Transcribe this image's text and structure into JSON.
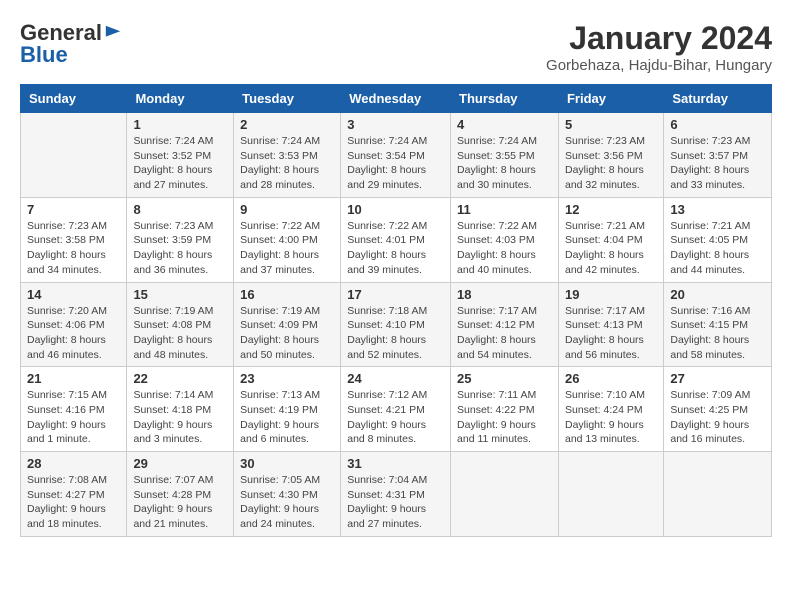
{
  "header": {
    "logo_line1": "General",
    "logo_line2": "Blue",
    "month_year": "January 2024",
    "location": "Gorbehaza, Hajdu-Bihar, Hungary"
  },
  "days_of_week": [
    "Sunday",
    "Monday",
    "Tuesday",
    "Wednesday",
    "Thursday",
    "Friday",
    "Saturday"
  ],
  "weeks": [
    [
      {
        "day": "",
        "sunrise": "",
        "sunset": "",
        "daylight": ""
      },
      {
        "day": "1",
        "sunrise": "Sunrise: 7:24 AM",
        "sunset": "Sunset: 3:52 PM",
        "daylight": "Daylight: 8 hours and 27 minutes."
      },
      {
        "day": "2",
        "sunrise": "Sunrise: 7:24 AM",
        "sunset": "Sunset: 3:53 PM",
        "daylight": "Daylight: 8 hours and 28 minutes."
      },
      {
        "day": "3",
        "sunrise": "Sunrise: 7:24 AM",
        "sunset": "Sunset: 3:54 PM",
        "daylight": "Daylight: 8 hours and 29 minutes."
      },
      {
        "day": "4",
        "sunrise": "Sunrise: 7:24 AM",
        "sunset": "Sunset: 3:55 PM",
        "daylight": "Daylight: 8 hours and 30 minutes."
      },
      {
        "day": "5",
        "sunrise": "Sunrise: 7:23 AM",
        "sunset": "Sunset: 3:56 PM",
        "daylight": "Daylight: 8 hours and 32 minutes."
      },
      {
        "day": "6",
        "sunrise": "Sunrise: 7:23 AM",
        "sunset": "Sunset: 3:57 PM",
        "daylight": "Daylight: 8 hours and 33 minutes."
      }
    ],
    [
      {
        "day": "7",
        "sunrise": "Sunrise: 7:23 AM",
        "sunset": "Sunset: 3:58 PM",
        "daylight": "Daylight: 8 hours and 34 minutes."
      },
      {
        "day": "8",
        "sunrise": "Sunrise: 7:23 AM",
        "sunset": "Sunset: 3:59 PM",
        "daylight": "Daylight: 8 hours and 36 minutes."
      },
      {
        "day": "9",
        "sunrise": "Sunrise: 7:22 AM",
        "sunset": "Sunset: 4:00 PM",
        "daylight": "Daylight: 8 hours and 37 minutes."
      },
      {
        "day": "10",
        "sunrise": "Sunrise: 7:22 AM",
        "sunset": "Sunset: 4:01 PM",
        "daylight": "Daylight: 8 hours and 39 minutes."
      },
      {
        "day": "11",
        "sunrise": "Sunrise: 7:22 AM",
        "sunset": "Sunset: 4:03 PM",
        "daylight": "Daylight: 8 hours and 40 minutes."
      },
      {
        "day": "12",
        "sunrise": "Sunrise: 7:21 AM",
        "sunset": "Sunset: 4:04 PM",
        "daylight": "Daylight: 8 hours and 42 minutes."
      },
      {
        "day": "13",
        "sunrise": "Sunrise: 7:21 AM",
        "sunset": "Sunset: 4:05 PM",
        "daylight": "Daylight: 8 hours and 44 minutes."
      }
    ],
    [
      {
        "day": "14",
        "sunrise": "Sunrise: 7:20 AM",
        "sunset": "Sunset: 4:06 PM",
        "daylight": "Daylight: 8 hours and 46 minutes."
      },
      {
        "day": "15",
        "sunrise": "Sunrise: 7:19 AM",
        "sunset": "Sunset: 4:08 PM",
        "daylight": "Daylight: 8 hours and 48 minutes."
      },
      {
        "day": "16",
        "sunrise": "Sunrise: 7:19 AM",
        "sunset": "Sunset: 4:09 PM",
        "daylight": "Daylight: 8 hours and 50 minutes."
      },
      {
        "day": "17",
        "sunrise": "Sunrise: 7:18 AM",
        "sunset": "Sunset: 4:10 PM",
        "daylight": "Daylight: 8 hours and 52 minutes."
      },
      {
        "day": "18",
        "sunrise": "Sunrise: 7:17 AM",
        "sunset": "Sunset: 4:12 PM",
        "daylight": "Daylight: 8 hours and 54 minutes."
      },
      {
        "day": "19",
        "sunrise": "Sunrise: 7:17 AM",
        "sunset": "Sunset: 4:13 PM",
        "daylight": "Daylight: 8 hours and 56 minutes."
      },
      {
        "day": "20",
        "sunrise": "Sunrise: 7:16 AM",
        "sunset": "Sunset: 4:15 PM",
        "daylight": "Daylight: 8 hours and 58 minutes."
      }
    ],
    [
      {
        "day": "21",
        "sunrise": "Sunrise: 7:15 AM",
        "sunset": "Sunset: 4:16 PM",
        "daylight": "Daylight: 9 hours and 1 minute."
      },
      {
        "day": "22",
        "sunrise": "Sunrise: 7:14 AM",
        "sunset": "Sunset: 4:18 PM",
        "daylight": "Daylight: 9 hours and 3 minutes."
      },
      {
        "day": "23",
        "sunrise": "Sunrise: 7:13 AM",
        "sunset": "Sunset: 4:19 PM",
        "daylight": "Daylight: 9 hours and 6 minutes."
      },
      {
        "day": "24",
        "sunrise": "Sunrise: 7:12 AM",
        "sunset": "Sunset: 4:21 PM",
        "daylight": "Daylight: 9 hours and 8 minutes."
      },
      {
        "day": "25",
        "sunrise": "Sunrise: 7:11 AM",
        "sunset": "Sunset: 4:22 PM",
        "daylight": "Daylight: 9 hours and 11 minutes."
      },
      {
        "day": "26",
        "sunrise": "Sunrise: 7:10 AM",
        "sunset": "Sunset: 4:24 PM",
        "daylight": "Daylight: 9 hours and 13 minutes."
      },
      {
        "day": "27",
        "sunrise": "Sunrise: 7:09 AM",
        "sunset": "Sunset: 4:25 PM",
        "daylight": "Daylight: 9 hours and 16 minutes."
      }
    ],
    [
      {
        "day": "28",
        "sunrise": "Sunrise: 7:08 AM",
        "sunset": "Sunset: 4:27 PM",
        "daylight": "Daylight: 9 hours and 18 minutes."
      },
      {
        "day": "29",
        "sunrise": "Sunrise: 7:07 AM",
        "sunset": "Sunset: 4:28 PM",
        "daylight": "Daylight: 9 hours and 21 minutes."
      },
      {
        "day": "30",
        "sunrise": "Sunrise: 7:05 AM",
        "sunset": "Sunset: 4:30 PM",
        "daylight": "Daylight: 9 hours and 24 minutes."
      },
      {
        "day": "31",
        "sunrise": "Sunrise: 7:04 AM",
        "sunset": "Sunset: 4:31 PM",
        "daylight": "Daylight: 9 hours and 27 minutes."
      },
      {
        "day": "",
        "sunrise": "",
        "sunset": "",
        "daylight": ""
      },
      {
        "day": "",
        "sunrise": "",
        "sunset": "",
        "daylight": ""
      },
      {
        "day": "",
        "sunrise": "",
        "sunset": "",
        "daylight": ""
      }
    ]
  ]
}
